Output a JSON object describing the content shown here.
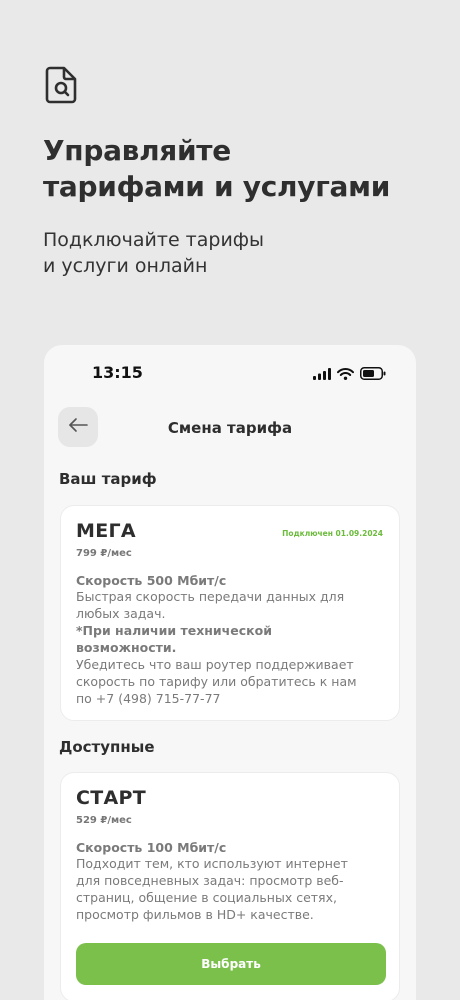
{
  "promo": {
    "icon": "document-search-icon",
    "title_line1": "Управляйте",
    "title_line2": "тарифами и услугами",
    "subtitle_line1": "Подключайте тарифы",
    "subtitle_line2": "и услуги онлайн"
  },
  "status_bar": {
    "time": "13:15",
    "icons": [
      "signal-icon",
      "wifi-icon",
      "battery-icon"
    ]
  },
  "nav": {
    "back_icon": "arrow-left-icon",
    "title": "Смена тарифа"
  },
  "current_section": {
    "label": "Ваш тариф",
    "tariff": {
      "name": "МЕГА",
      "price": "799 ₽/мес",
      "badge": "Подключен 01.09.2024",
      "speed": "Скорость 500 Мбит/с",
      "desc_lines": [
        "Быстрая скорость передачи данных для",
        "любых задач."
      ],
      "note_lines": [
        "*При наличии технической",
        "возможности."
      ],
      "info_lines": [
        "Убедитесь что ваш роутер поддерживает",
        "скорость по тарифу или обратитесь к нам",
        "по +7 (498) 715-77-77"
      ]
    }
  },
  "available_section": {
    "label": "Доступные",
    "tariff": {
      "name": "СТАРТ",
      "price": "529 ₽/мес",
      "speed": "Скорость 100 Мбит/с",
      "desc_lines": [
        "Подходит тем, кто используют интернет",
        "для повседневных задач: просмотр веб-",
        "страниц, общение в социальных сетях,",
        "просмотр фильмов в HD+ качестве."
      ],
      "button_label": "Выбрать"
    }
  },
  "colors": {
    "accent": "#7cc04c",
    "badge": "#6cbb3c",
    "background": "#e9e9e9"
  }
}
